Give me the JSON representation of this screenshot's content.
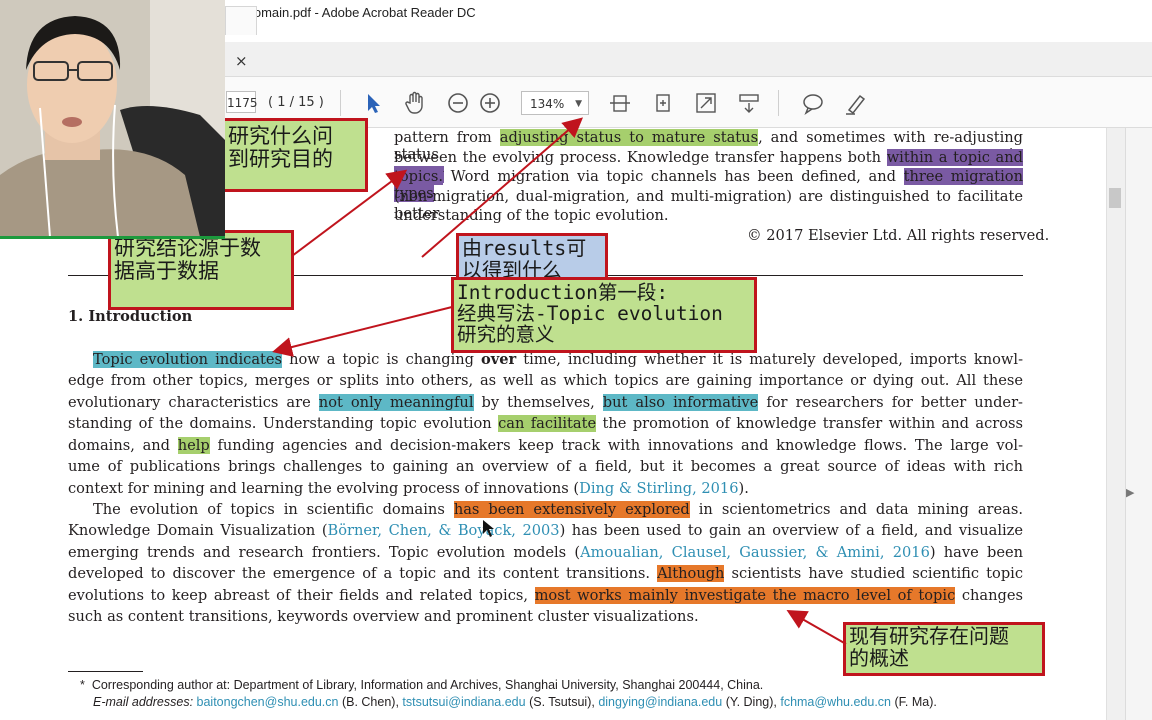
{
  "window": {
    "title": "fic domain.pdf - Adobe Acrobat Reader DC"
  },
  "tab": {
    "close_glyph": "×"
  },
  "toolbar": {
    "page_number": "1175",
    "page_count": "( 1 / 15 )",
    "zoom": "134%",
    "zoom_caret": "▼",
    "icons": [
      "select-cursor-icon",
      "hand-tool-icon",
      "zoom-out-icon",
      "zoom-in-icon",
      "fit-page-icon",
      "rotate-icon",
      "full-screen-icon",
      "scroll-mode-icon",
      "comment-icon",
      "highlight-pen-icon"
    ]
  },
  "abstract": {
    "l1_a": "pattern from ",
    "l1_hl": "adjusting status to mature status",
    "l1_b": ", and sometimes with re-adjusting status in",
    "l2_a": "between the evolving process. Knowledge transfer happens both ",
    "l2_hl": "within a topic and among",
    "l3_hl": "topics.",
    "l3_a": " Word migration via topic channels has been defined, and ",
    "l3_hl2": "three migration types",
    "l4": "(non-migration, dual-migration, and multi-migration) are distinguished to facilitate better",
    "l5": "understanding of the topic evolution.",
    "copyright": "© 2017 Elsevier Ltd. All rights reserved."
  },
  "section": {
    "heading": "1.  Introduction"
  },
  "para1": {
    "l1_hl": "Topic evolution indicates",
    "l1_a": " how a topic is changing ",
    "l1_bold": "over",
    "l1_b": " time, including whether it is maturely developed, imports knowl-",
    "l2": "edge from other topics, merges or splits into others, as well as which topics are gaining importance or dying out. All these",
    "l3_a": "evolutionary characteristics are ",
    "l3_hl": "not only meaningful",
    "l3_b": " by themselves, ",
    "l3_hl2": "but also informative",
    "l3_c": " for researchers for better under-",
    "l4_a": "standing of the domains. Understanding topic evolution ",
    "l4_hl": "can facilitate",
    "l4_b": " the promotion of knowledge transfer within and across",
    "l5_a": "domains, and ",
    "l5_hl": "help",
    "l5_b": " funding agencies and decision-makers keep track with innovations and knowledge flows. The large vol-",
    "l6": "ume of publications brings challenges to gaining an overview of a field, but it becomes a great source of ideas with rich",
    "l7_a": "context for mining and learning the evolving process of innovations (",
    "l7_cite": "Ding & Stirling, 2016",
    "l7_b": ")."
  },
  "para2": {
    "l1_a": "The evolution of topics in scientific domains ",
    "l1_hl": "has been extensively explored",
    "l1_b": " in scientometrics and data mining areas.",
    "l2_a": "Knowledge Domain Visualization (",
    "l2_cite": "Börner, Chen, & Boyack, 2003",
    "l2_b": ") has been used to gain an overview of a field, and visualize",
    "l3_a": "emerging trends and research frontiers. Topic evolution models (",
    "l3_cite": "Amoualian, Clausel, Gaussier, & Amini, 2016",
    "l3_b": ") have been",
    "l4_a": "developed to discover the emergence of a topic and its content transitions. ",
    "l4_hl": "Although",
    "l4_b": " scientists have studied scientific topic",
    "l5_a": "evolutions to keep abreast of their fields and related topics, ",
    "l5_hl": "most works mainly investigate the macro level of topic",
    "l5_b": " changes",
    "l6": "such as content transitions, keywords overview and prominent cluster visualizations."
  },
  "footnote": {
    "star": "*",
    "corr": "Corresponding author at: Department of Library, Information and Archives, Shanghai University, Shanghai 200444, China.",
    "email_label": "E-mail addresses: ",
    "e1": "baitongchen@shu.edu.cn",
    "n1": " (B. Chen), ",
    "e2": "tstsutsui@indiana.edu",
    "n2": " (S. Tsutsui), ",
    "e3": "dingying@indiana.edu",
    "n3": " (Y. Ding), ",
    "e4": "fchma@whu.edu.cn",
    "n4": " (F. Ma)."
  },
  "notes": {
    "top_l1": "研究什么问",
    "top_l2": "到研究目的",
    "conclusion_l1": "研究结论源于数",
    "conclusion_l2": "据高于数据",
    "results_l1": "由results可",
    "results_l2": "以得到什么",
    "intro_l1": "Introduction第一段:",
    "intro_l2": "经典写法-Topic evolution",
    "intro_l3": "研究的意义",
    "problem_l1": "现有研究存在问题",
    "problem_l2": "的概述"
  },
  "colors": {
    "highlight_green": "#a6cf6d",
    "highlight_purple": "#7a5aa3",
    "highlight_blue": "#5db8c6",
    "highlight_orange": "#e6782a",
    "note_border": "#c0141d",
    "note_fill": "#bfe08f",
    "note_blue_fill": "#b8cce8",
    "citation": "#2f8fb3"
  }
}
